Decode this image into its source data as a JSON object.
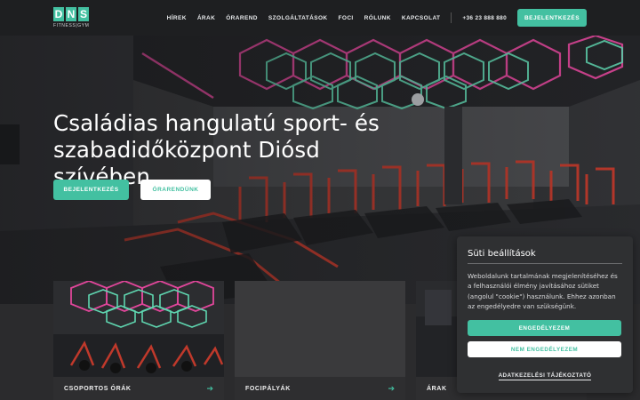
{
  "header": {
    "logo_letters": [
      "D",
      "N",
      "S"
    ],
    "logo_sub": "FITNESS|GYM",
    "nav": [
      "HÍREK",
      "ÁRAK",
      "ÓRAREND",
      "SZOLGÁLTATÁSOK",
      "FOCI",
      "RÓLUNK",
      "KAPCSOLAT"
    ],
    "phone": "+36 23 888 880",
    "login_label": "BEJELENTKEZÉS"
  },
  "hero": {
    "title": "Családias hangulatú sport- és szabadidőközpont Diósd szívében.",
    "primary_button": "BEJELENTKEZÉS",
    "secondary_button": "ÓRARENDÜNK"
  },
  "cards": [
    {
      "label": "CSOPORTOS ÓRÁK",
      "arrow": "➔"
    },
    {
      "label": "FOCIPÁLYÁK",
      "arrow": "➔"
    },
    {
      "label": "ÁRAK",
      "arrow": "➔"
    }
  ],
  "cookie": {
    "title": "Süti beállítások",
    "text": "Weboldalunk tartalmának megjelenítéséhez és a felhasználói élmény javításához sütiket (angolul \"cookie\") használunk. Ehhez azonban az engedélyedre van szükségünk.",
    "accept": "ENGEDÉLYEZEM",
    "decline": "NEM ENGEDÉLYEZEM",
    "privacy_link": "ADATKEZELÉSI TÁJÉKOZTATÓ"
  },
  "colors": {
    "accent": "#43c0a1",
    "header_bg": "#1e1f21",
    "panel_bg": "#2f3032",
    "neon_pink": "#e0469a",
    "neon_green": "#5fd6b0",
    "equipment_red": "#c0392b"
  }
}
